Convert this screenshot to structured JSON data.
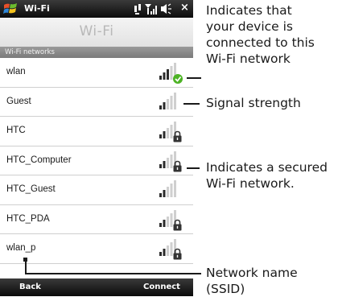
{
  "status_bar": {
    "title": "Wi-Fi",
    "close_glyph": "×",
    "icons": [
      "windows-logo-icon",
      "connectivity-icon",
      "signal-bars-icon",
      "volume-icon"
    ]
  },
  "page_title": "Wi-Fi",
  "section_header": "Wi-Fi networks",
  "networks": [
    {
      "name": "wlan",
      "icon": "signal-connected-icon",
      "signal": 0.6,
      "connected": true,
      "secured": false
    },
    {
      "name": "Guest",
      "icon": "signal-icon",
      "signal": 0.4,
      "connected": false,
      "secured": false
    },
    {
      "name": "HTC",
      "icon": "signal-secured-icon",
      "signal": 0.4,
      "connected": false,
      "secured": true
    },
    {
      "name": "HTC_Computer",
      "icon": "signal-secured-icon",
      "signal": 0.4,
      "connected": false,
      "secured": true
    },
    {
      "name": "HTC_Guest",
      "icon": "signal-icon",
      "signal": 0.4,
      "connected": false,
      "secured": false
    },
    {
      "name": "HTC_PDA",
      "icon": "signal-secured-icon",
      "signal": 0.4,
      "connected": false,
      "secured": true
    },
    {
      "name": "wlan_p",
      "icon": "signal-secured-icon",
      "signal": 0.4,
      "connected": false,
      "secured": true
    }
  ],
  "softkeys": {
    "left": "Back",
    "right": "Connect"
  },
  "callouts": {
    "connected": [
      "Indicates that",
      "your device is",
      "connected to this",
      "Wi-Fi network"
    ],
    "signal": [
      "Signal strength"
    ],
    "secured": [
      "Indicates a secured",
      "Wi-Fi network."
    ],
    "ssid": [
      "Network name (SSID)"
    ]
  },
  "colors": {
    "connected_check": "#4db325",
    "bar_active": "#2b2b2b",
    "bar_inactive": "#cfcfcf",
    "lock": "#333333"
  }
}
